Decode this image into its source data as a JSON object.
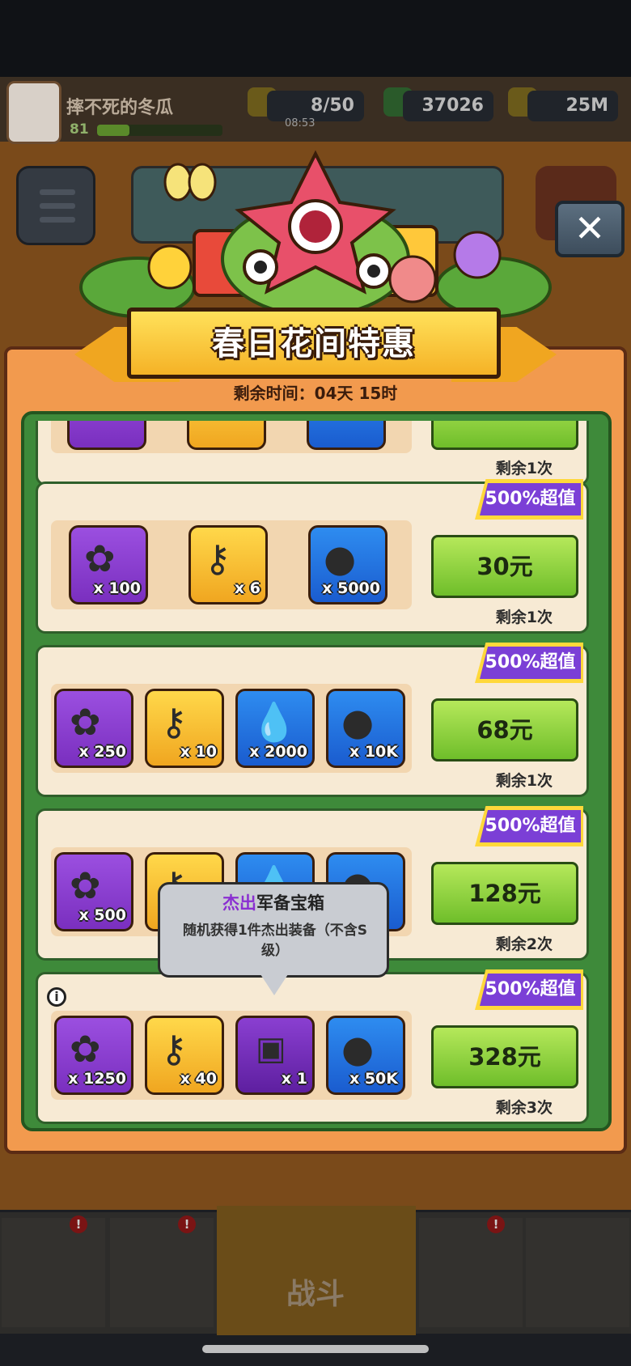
{
  "hud": {
    "player_name": "摔不死的冬瓜",
    "level": "81",
    "energy": "8/50",
    "energy_timer": "08:53",
    "gems": "37026",
    "coins": "25M"
  },
  "nav": {
    "battle_label": "战斗",
    "badge": "!"
  },
  "popup": {
    "title": "春日花间特惠",
    "time_left": "剩余时间：04天 15时",
    "close_label": "✕",
    "packs": [
      {
        "ribbon": "",
        "price": "",
        "remaining": "剩余1次",
        "items": []
      },
      {
        "ribbon": "500%超值",
        "price": "30元",
        "remaining": "剩余1次",
        "items": [
          {
            "qty": "x 100",
            "icon": "flower-icon"
          },
          {
            "qty": "x 6",
            "icon": "key-icon"
          },
          {
            "qty": "x 5000",
            "icon": "coin-icon"
          }
        ]
      },
      {
        "ribbon": "500%超值",
        "price": "68元",
        "remaining": "剩余1次",
        "items": [
          {
            "qty": "x 250",
            "icon": "flower-icon"
          },
          {
            "qty": "x 10",
            "icon": "key-icon"
          },
          {
            "qty": "x 2000",
            "icon": "drop-icon"
          },
          {
            "qty": "x 10K",
            "icon": "coin-icon"
          }
        ]
      },
      {
        "ribbon": "500%超值",
        "price": "128元",
        "remaining": "剩余2次",
        "items": [
          {
            "qty": "x 500",
            "icon": "flower-icon"
          },
          {
            "qty": "",
            "icon": "key-icon"
          },
          {
            "qty": "",
            "icon": "drop-icon"
          },
          {
            "qty": "",
            "icon": "coin-icon"
          }
        ]
      },
      {
        "ribbon": "500%超值",
        "price": "328元",
        "remaining": "剩余3次",
        "items": [
          {
            "qty": "x 1250",
            "icon": "flower-icon"
          },
          {
            "qty": "x 40",
            "icon": "key-icon"
          },
          {
            "qty": "x 1",
            "icon": "mystery-chest-icon"
          },
          {
            "qty": "x 50K",
            "icon": "coin-icon"
          }
        ]
      }
    ],
    "tooltip": {
      "title_highlight": "杰出",
      "title_rest": "军备宝箱",
      "description": "随机获得1件杰出装备（不含S级）"
    },
    "info_label": "i"
  },
  "colors": {
    "ribbon_purple": "#7b3fd6",
    "buy_green": "#6fbe2a",
    "panel_orange": "#f29a4e"
  }
}
